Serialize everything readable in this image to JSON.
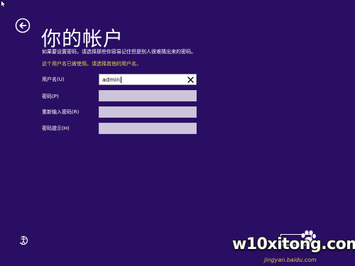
{
  "page": {
    "title": "你的帐户"
  },
  "instructions": "如果要设置密码，请选择那些你容易记住但是别人很难猜出来的密码。",
  "error_message": "这个用户名已被使用。请选择其他的用户名。",
  "fields": [
    {
      "label": "用户名(U)",
      "value": "admin"
    },
    {
      "label": "密码(P)",
      "value": ""
    },
    {
      "label": "重新输入密码(R)",
      "value": ""
    },
    {
      "label": "密码提示(H)",
      "value": ""
    }
  ],
  "watermark": {
    "main": "w10xitong.com",
    "sub": "jingyan.baidu.com"
  },
  "colors": {
    "background": "#2a0e63",
    "error_text": "#e6d84a",
    "input_fill": "#cdc5dc"
  },
  "icons": {
    "back": "back-arrow-circle-icon",
    "clear": "close-icon",
    "ease_of_access": "ease-of-access-icon",
    "cursor": "mouse-pointer-icon"
  }
}
